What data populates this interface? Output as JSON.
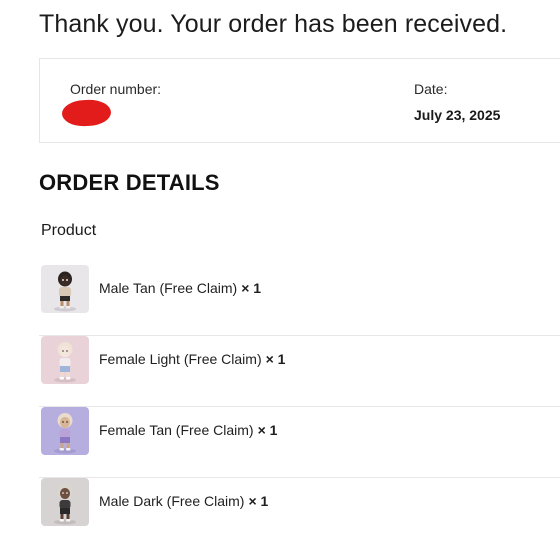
{
  "page": {
    "title": "Thank you. Your order has been received."
  },
  "order_overview": {
    "order_number_label": "Order number:",
    "order_number_value_redacted": true,
    "date_label": "Date:",
    "date_value": "July 23, 2025"
  },
  "order_details": {
    "heading": "ORDER DETAILS",
    "product_column_header": "Product",
    "items": [
      {
        "name": "Male Tan (Free Claim)",
        "quantity": "× 1",
        "thumbnail": "avatar-figure-male-tan",
        "thumb_bg": "#e9e6ea"
      },
      {
        "name": "Female Light (Free Claim)",
        "quantity": "× 1",
        "thumbnail": "avatar-figure-female-light",
        "thumb_bg": "#e9d3d8"
      },
      {
        "name": "Female Tan (Free Claim)",
        "quantity": "× 1",
        "thumbnail": "avatar-figure-female-tan",
        "thumb_bg": "#b7aee0"
      },
      {
        "name": "Male Dark (Free Claim)",
        "quantity": "× 1",
        "thumbnail": "avatar-figure-male-dark",
        "thumb_bg": "#d7d3d2"
      }
    ]
  },
  "colors": {
    "redaction": "#e21b1b",
    "border": "#e6e6e6",
    "text": "#1a1a1a"
  }
}
